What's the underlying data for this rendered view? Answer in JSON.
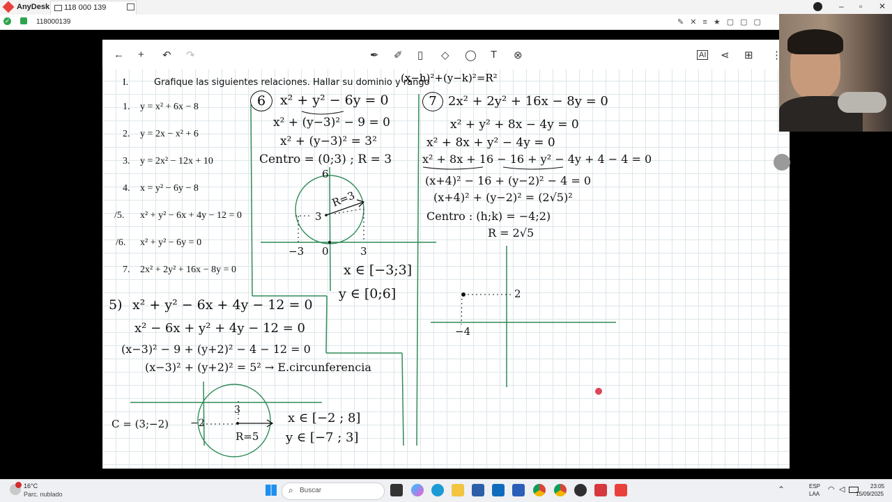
{
  "titlebar": {
    "app_name": "AnyDesk",
    "session_tab": "118 000 139",
    "address": "118000139"
  },
  "board": {
    "task_number": "I.",
    "task_title": "Grafique las siguientes relaciones.  Hallar su dominio y rango",
    "equations": [
      {
        "num": "1.",
        "text": "y = x² + 6x − 8"
      },
      {
        "num": "2.",
        "text": "y = 2x − x² + 6"
      },
      {
        "num": "3.",
        "text": "y = 2x² − 12x + 10"
      },
      {
        "num": "4.",
        "text": "x = y² − 6y − 8"
      },
      {
        "num": "/5.",
        "text": "x² + y² − 6x + 4y − 12 = 0"
      },
      {
        "num": "/6.",
        "text": "x² + y² − 6y = 0"
      },
      {
        "num": "7.",
        "text": "2x² + 2y² + 16x − 8y = 0"
      }
    ],
    "std_form": "(x−h)²+(y−k)²=R²",
    "problem6": {
      "tag": "6",
      "lines": [
        "x² + y² − 6y = 0",
        "x² + (y−3)² − 9 = 0",
        "x² + (y−3)² = 3²",
        "Centro = (0;3) ; R = 3"
      ],
      "top_label": "6",
      "radius_label": "R=3",
      "center_label": "3",
      "x_labels": [
        "−3",
        "0",
        "3"
      ],
      "domain": "x ∈ [−3;3]",
      "range": "y ∈ [0;6]"
    },
    "problem7": {
      "tag": "7",
      "lines": [
        "2x² + 2y² + 16x − 8y = 0",
        "x² + y² + 8x − 4y = 0",
        "x² + 8x + y² − 4y = 0",
        "x² + 8x + 16 − 16 + y² − 4y + 4 − 4 = 0",
        "(x+4)² − 16 + (y−2)² − 4 = 0",
        "(x+4)² + (y−2)² = (2√5)²",
        "Centro : (h;k) = −4;2)",
        "R = 2√5"
      ],
      "y_label": "2",
      "x_label": "−4"
    },
    "problem5": {
      "tag": "5)",
      "lines": [
        "x² + y² − 6x + 4y − 12 = 0",
        "x² − 6x + y² + 4y − 12 = 0",
        "(x−3)² − 9 + (y+2)² − 4 − 12 = 0",
        "(x−3)² + (y+2)² = 5² → E.circunferencia"
      ],
      "center_text": "C = (3;−2)",
      "left_label": "−2",
      "top_label": "3",
      "radius_label": "R=5",
      "domain": "x ∈ [−2 ; 8]",
      "range": "y ∈ [−7 ; 3]"
    }
  },
  "taskbar": {
    "weather_temp": "16°C",
    "weather_desc": "Parc. nublado",
    "search_placeholder": "Buscar",
    "lang": "ESP",
    "lang_sub": "LAA",
    "time": "23:05",
    "date": "15/09/2025"
  },
  "colors": {
    "grid": "#dde6ea",
    "axis_green": "#2e8b57",
    "ink": "#111111",
    "anydesk_red": "#e8413c"
  }
}
